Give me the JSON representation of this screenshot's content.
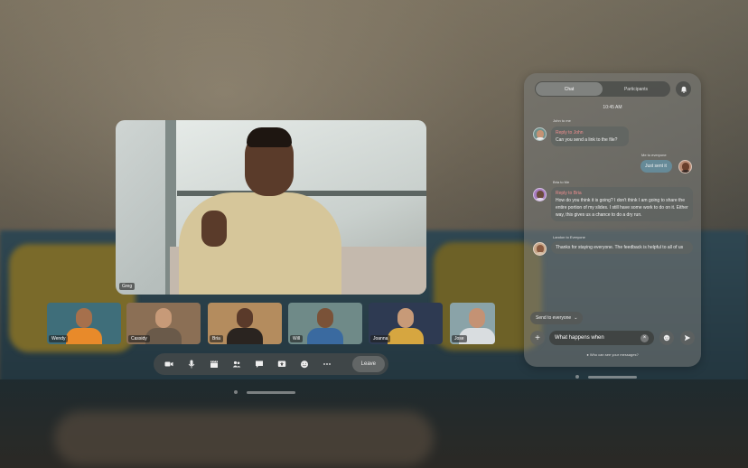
{
  "main_video": {
    "participant": "Greg"
  },
  "thumbnails": [
    {
      "name": "Wendy",
      "bg": "#3f6e7a",
      "face": "#a6704c",
      "torso": "#e88a2a"
    },
    {
      "name": "Cassidy",
      "bg": "#8b6f55",
      "face": "#c79a78",
      "torso": "#6a5a4a"
    },
    {
      "name": "Bria",
      "bg": "#b48c5e",
      "face": "#5a3a2a",
      "torso": "#2a2420"
    },
    {
      "name": "Will",
      "bg": "#6f8a88",
      "face": "#7a5238",
      "torso": "#3a6aa0"
    },
    {
      "name": "Joanna",
      "bg": "#2e3a52",
      "face": "#c79a78",
      "torso": "#d6a640"
    },
    {
      "name": "Jose",
      "bg": "#8aa3a8",
      "face": "#c49274",
      "torso": "#d9dde0"
    }
  ],
  "controls": {
    "buttons": [
      "video-icon",
      "microphone-icon",
      "clapperboard-icon",
      "participants-icon",
      "chat-icon",
      "share-screen-icon",
      "reactions-icon",
      "more-icon"
    ],
    "leave_label": "Leave"
  },
  "chat": {
    "tabs": [
      "Chat",
      "Participants"
    ],
    "time": "10:45 AM",
    "messages": [
      {
        "meta": "John to me",
        "sender": "Reply to John",
        "text": "Can you send a link to the file?"
      },
      {
        "meta": "Me to everyone",
        "text": "Just sent it"
      },
      {
        "meta": "Bria to Me",
        "sender": "Reply to Bria",
        "text": "How do you think it is going? I don't think I am going to share the entire portion of my slides. I still have some work to do on it. Either way, this gives us a chance to do a dry run."
      },
      {
        "meta": "Landon to Everyone",
        "text": "Thanks for staying everyone. The feedback is helpful to all of us"
      }
    ],
    "send_to": "Send to everyone",
    "input_value": "What happens when",
    "footnote": "Who can see your messages?"
  }
}
